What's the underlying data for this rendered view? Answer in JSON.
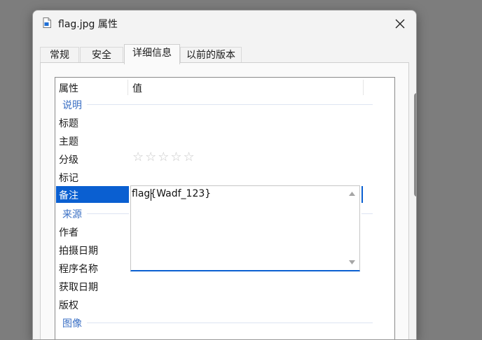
{
  "window": {
    "title": "flag.jpg 属性"
  },
  "tabs": [
    "常规",
    "安全",
    "详细信息",
    "以前的版本"
  ],
  "columns": {
    "property": "属性",
    "value": "值"
  },
  "groups": {
    "description": "说明",
    "origin": "来源",
    "image": "图像"
  },
  "description_rows": [
    "标题",
    "主题",
    "分级",
    "标记",
    "备注"
  ],
  "origin_rows": [
    "作者",
    "拍摄日期",
    "程序名称",
    "获取日期",
    "版权"
  ],
  "rating": {
    "stars_text": "☆☆☆☆☆",
    "value": 0,
    "max": 5
  },
  "comment_editor": {
    "value": "flag{Wadf_123}"
  },
  "colors": {
    "accent": "#0a5fd1",
    "group_header": "#3a6fc4"
  }
}
